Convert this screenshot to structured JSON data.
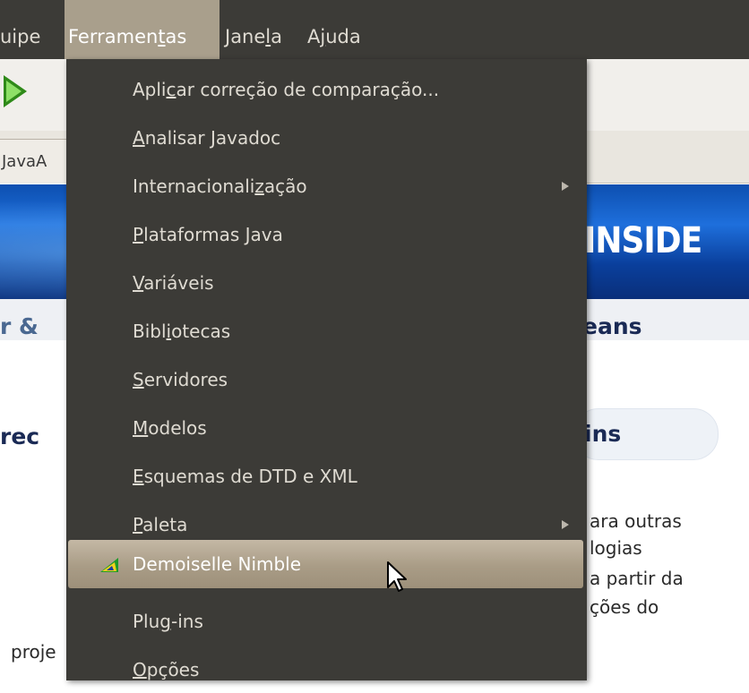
{
  "menubar": {
    "items": [
      {
        "label": "uipe"
      },
      {
        "label": "Ferramentas",
        "mnemonic_before": "Ferramen",
        "mnemonic": "t",
        "mnemonic_after": "as"
      },
      {
        "label": "Janela",
        "mnemonic_before": "Jane",
        "mnemonic": "l",
        "mnemonic_after": "a"
      },
      {
        "label": "Ajuda",
        "mnemonic_before": "A",
        "mnemonic": "j",
        "mnemonic_after": "uda"
      }
    ]
  },
  "background": {
    "tab_label": "JavaA",
    "banner_logo": "INSIDE",
    "heading_left": "r &",
    "heading_right": "eans",
    "sub_left": "rec",
    "plugins_label": "ins",
    "para_lines": [
      "ara outras",
      "logias",
      "a partir da",
      "ções do"
    ],
    "bottom_left": "proje"
  },
  "menu": {
    "items": [
      {
        "pre": "Apli",
        "u": "c",
        "post": "ar correção de comparação...",
        "submenu": false
      },
      {
        "pre": "",
        "u": "A",
        "post": "nalisar Javadoc",
        "submenu": false
      },
      {
        "pre": "Internacionali",
        "u": "z",
        "post": "ação",
        "submenu": true
      },
      {
        "pre": "",
        "u": "P",
        "post": "lataformas Java",
        "submenu": false
      },
      {
        "pre": "",
        "u": "V",
        "post": "ariáveis",
        "submenu": false
      },
      {
        "pre": "Bibl",
        "u": "i",
        "post": "otecas",
        "submenu": false
      },
      {
        "pre": "",
        "u": "S",
        "post": "ervidores",
        "submenu": false
      },
      {
        "pre": "",
        "u": "M",
        "post": "odelos",
        "submenu": false
      },
      {
        "pre": "",
        "u": "E",
        "post": "squemas de DTD e XML",
        "submenu": false
      },
      {
        "pre": "",
        "u": "P",
        "post": "aleta",
        "submenu": true
      },
      {
        "pre": "Demoiselle Nimble",
        "u": "",
        "post": "",
        "submenu": false,
        "highlighted": true,
        "icon": "brazil-flag-icon"
      },
      {
        "pre": "Plu",
        "u": "g",
        "post": "-ins",
        "submenu": false
      },
      {
        "pre": "",
        "u": "O",
        "post": "pções",
        "submenu": false
      }
    ]
  },
  "colors": {
    "menu_bg": "#3c3b37",
    "menu_text": "#dfdbd2",
    "highlight": "#a99c86",
    "banner": "#1e6fdc"
  }
}
